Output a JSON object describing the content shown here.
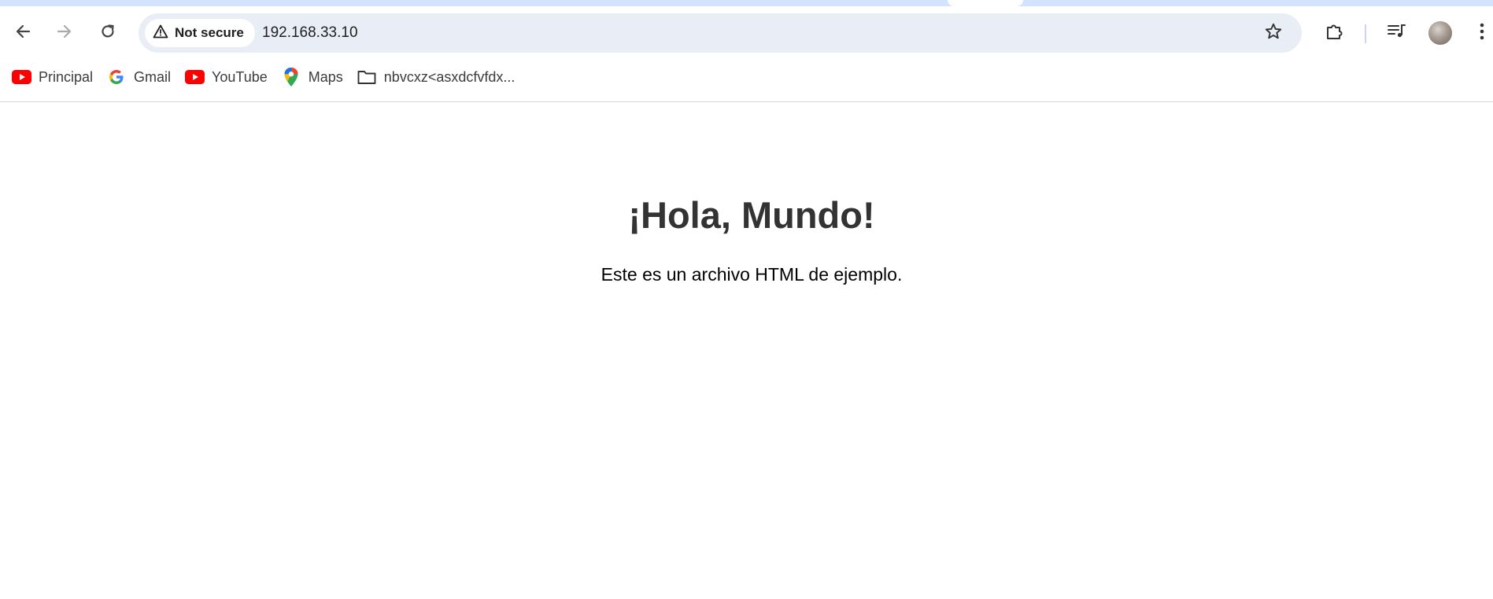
{
  "browser": {
    "security_label": "Not secure",
    "url": "192.168.33.10",
    "icons": {
      "back": "back-arrow-icon",
      "forward": "forward-arrow-icon",
      "reload": "reload-icon",
      "warning": "warning-triangle-icon",
      "bookmark_star": "star-icon",
      "extensions": "puzzle-icon",
      "media": "media-queue-icon",
      "menu": "kebab-menu-icon"
    },
    "colors": {
      "tabstrip": "#d3e3fd",
      "omnibox": "#e9eef6",
      "youtube_red": "#ff0000"
    }
  },
  "bookmarks": [
    {
      "label": "Principal",
      "icon": "youtube-icon"
    },
    {
      "label": "Gmail",
      "icon": "google-icon"
    },
    {
      "label": "YouTube",
      "icon": "youtube-icon"
    },
    {
      "label": "Maps",
      "icon": "maps-pin-icon"
    },
    {
      "label": "nbvcxz<asxdcfvfdx...",
      "icon": "folder-icon"
    }
  ],
  "page": {
    "heading": "¡Hola, Mundo!",
    "paragraph": "Este es un archivo HTML de ejemplo."
  }
}
